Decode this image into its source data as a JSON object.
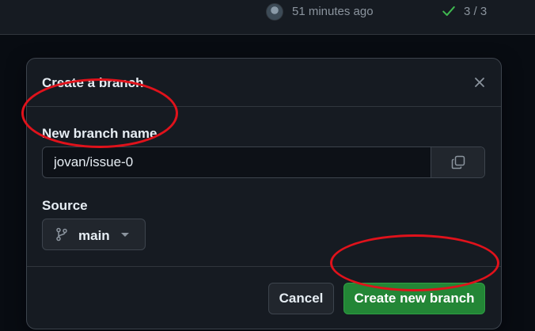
{
  "topbar": {
    "time": "51 minutes ago",
    "checks": "3 / 3",
    "check_color": "#3fb950"
  },
  "dialog": {
    "title": "Create a branch",
    "close_icon": "x-icon",
    "branch_field": {
      "label": "New branch name",
      "value": "jovan/issue-0",
      "copy_icon": "copy-icon"
    },
    "source": {
      "label": "Source",
      "branch": "main",
      "icon": "git-branch-icon"
    },
    "buttons": {
      "cancel": "Cancel",
      "create": "Create new branch"
    }
  },
  "colors": {
    "primary_button": "#238636",
    "annotation": "#e0121b",
    "background": "#0d1117"
  }
}
